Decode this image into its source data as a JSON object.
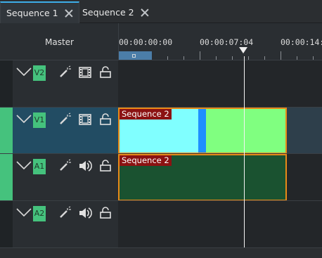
{
  "tabs": [
    {
      "label": "Sequence 1",
      "active": true
    },
    {
      "label": "Sequence 2",
      "active": false
    }
  ],
  "header": {
    "master_label": "Master"
  },
  "ruler": {
    "labels": [
      "00:00:00:00",
      "00:00:07:04",
      "00:00:14:0"
    ]
  },
  "tracks": [
    {
      "name": "V2",
      "type": "video",
      "selected": false,
      "clip": null
    },
    {
      "name": "V1",
      "type": "video",
      "selected": true,
      "clip": {
        "label": "Sequence 2"
      }
    },
    {
      "name": "A1",
      "type": "audio",
      "selected": false,
      "clip": {
        "label": "Sequence 2"
      }
    },
    {
      "name": "A2",
      "type": "audio",
      "selected": false,
      "clip": null
    }
  ],
  "colors": {
    "accent": "#3daee9",
    "track_green": "#45c27d",
    "clip_border": "#e88a17",
    "clip_label_bg": "#8b1212",
    "video_clip_cyan": "#80ffff",
    "video_clip_green": "#80ff80",
    "audio_clip": "#1a5230"
  },
  "icons": {
    "collapse": "chevron-down-icon",
    "effects": "magic-wand-icon",
    "video": "film-strip-icon",
    "audio": "speaker-icon",
    "lock": "lock-icon"
  }
}
